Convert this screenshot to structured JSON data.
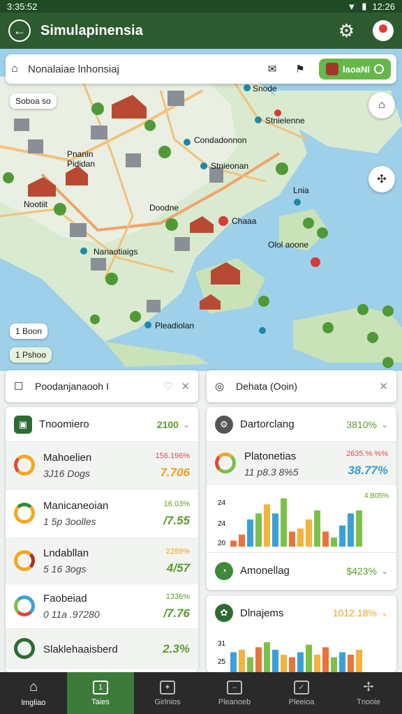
{
  "status": {
    "time": "3:35:52",
    "clock": "12:26"
  },
  "header": {
    "title": "Simulapinensia"
  },
  "search": {
    "text": "Nonalaiae lnhonsiaj",
    "toggle_label": "laoaNI"
  },
  "map": {
    "pill_top": "Soboa so",
    "labels": [
      {
        "text": "Snode",
        "id": "snode"
      },
      {
        "text": "Stnielenne",
        "id": "stnielenne"
      },
      {
        "text": "Condadonnon",
        "id": "condadonnon"
      },
      {
        "text": "Stnieonan",
        "id": "stnieonan"
      },
      {
        "text": "Pnanin Pididan",
        "id": "pididan"
      },
      {
        "text": "Nootiit",
        "id": "nootiit"
      },
      {
        "text": "Doodne",
        "id": "doodne"
      },
      {
        "text": "Chaaa",
        "id": "chaaa"
      },
      {
        "text": "Olol aoone",
        "id": "ololaoone"
      },
      {
        "text": "Nanaotiaigs",
        "id": "nanaotiaigs"
      },
      {
        "text": "Pleadiolan",
        "id": "pleadiolan"
      },
      {
        "text": "Lnia",
        "id": "lnia"
      }
    ],
    "pill_bottom_1": "1 Boon",
    "pill_bottom_2": "1 Pshoo"
  },
  "filters": {
    "left": "Poodanjanaooh I",
    "right": "Dehata (Ooin)"
  },
  "left_panel": {
    "head_title": "Tnoomiero",
    "head_value": "2100",
    "rows": [
      {
        "name": "Mahoelien",
        "sub": "3J16 Dogs",
        "pct": "156.196%",
        "val": "7.706"
      },
      {
        "name": "Manicaneoian",
        "sub": "1 5p 3oolles",
        "pct": "16.03%",
        "val": "/7.55"
      },
      {
        "name": "Lndabllan",
        "sub": "5 16 3ogs",
        "pct": "2289%",
        "val": "4/57"
      },
      {
        "name": "Faobeiad",
        "sub": "0 11a .97280",
        "pct": "1336%",
        "val": "/7.76"
      },
      {
        "name": "Slaklehaaisberd",
        "sub": "",
        "pct": "",
        "val": "2.3%"
      }
    ]
  },
  "right_panel_1": {
    "head_title": "Dartorclang",
    "head_value": "3810%",
    "metric_name": "Platonetias",
    "metric_sub": "11 p8.3 8%5",
    "metric_pct": "2635.% %%",
    "metric_val": "38.77%",
    "chart_annot": "4.B05%",
    "y_ticks": [
      "24",
      "24",
      "20"
    ],
    "footer_title": "Amonellag",
    "footer_value": "$423%"
  },
  "right_panel_2": {
    "head_title": "Dlnajems",
    "head_value": "1012.18%",
    "y_ticks": [
      "31",
      "25"
    ]
  },
  "nav": {
    "items": [
      {
        "label": "lmgliao"
      },
      {
        "label": "Taies"
      },
      {
        "label": "Girlnios"
      },
      {
        "label": "Pleanoeb"
      },
      {
        "label": "Pleeioa"
      },
      {
        "label": "Tnooie"
      }
    ]
  },
  "chart_data": [
    {
      "type": "bar",
      "values": [
        2,
        4,
        9,
        11,
        14,
        11,
        16,
        5,
        6,
        9,
        12,
        5,
        3,
        7,
        11,
        12
      ],
      "colors": [
        "#e8743b",
        "#e8743b",
        "#3aa0d8",
        "#7cc04a",
        "#f3b33d",
        "#3aa0d8",
        "#7cc04a",
        "#e8743b",
        "#f3b33d",
        "#f3b33d",
        "#7cc04a",
        "#e8743b",
        "#7cc04a",
        "#3aa0d8",
        "#3aa0d8",
        "#7cc04a"
      ],
      "ylim": [
        0,
        18
      ]
    },
    {
      "type": "bar",
      "values": [
        8,
        9,
        6,
        10,
        12,
        9,
        7,
        6,
        8,
        11,
        7,
        10,
        6,
        8,
        7,
        9
      ],
      "colors": [
        "#3aa0d8",
        "#f3b33d",
        "#7cc04a",
        "#e8743b",
        "#7cc04a",
        "#3aa0d8",
        "#f3b33d",
        "#e8743b",
        "#3aa0d8",
        "#7cc04a",
        "#f3b33d",
        "#e8743b",
        "#7cc04a",
        "#3aa0d8",
        "#e8743b",
        "#f3b33d"
      ],
      "ylim": [
        0,
        14
      ]
    }
  ],
  "colors": {
    "brand": "#2d5a2f",
    "accent": "#65b84a",
    "up": "#5c9a2c",
    "down": "#e14b4b"
  }
}
